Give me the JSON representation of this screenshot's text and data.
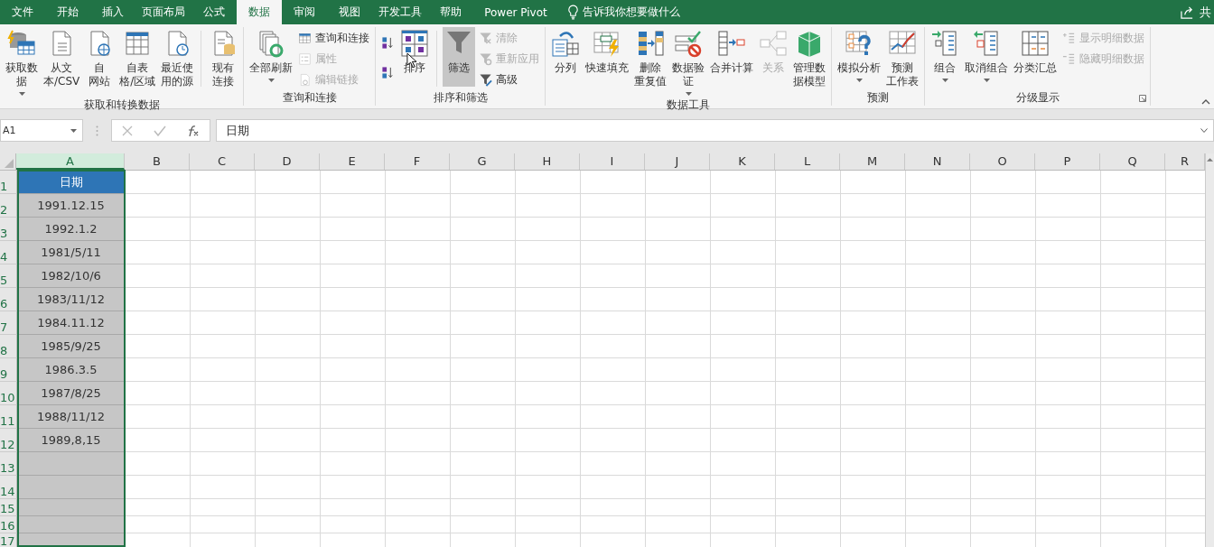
{
  "tabs": [
    {
      "label": "文件",
      "selected": false
    },
    {
      "label": "开始",
      "selected": false
    },
    {
      "label": "插入",
      "selected": false
    },
    {
      "label": "页面布局",
      "selected": false
    },
    {
      "label": "公式",
      "selected": false
    },
    {
      "label": "数据",
      "selected": true
    },
    {
      "label": "审阅",
      "selected": false
    },
    {
      "label": "视图",
      "selected": false
    },
    {
      "label": "开发工具",
      "selected": false
    },
    {
      "label": "帮助",
      "selected": false
    },
    {
      "label": "Power Pivot",
      "selected": false
    }
  ],
  "tell_me": "告诉我你想要做什么",
  "share": "共",
  "ribbon_groups": [
    {
      "label": "获取和转换数据",
      "items": [
        {
          "kind": "large",
          "lines": [
            "获取数",
            "据"
          ],
          "dropdown": true,
          "disabled": false,
          "pressed": false
        },
        {
          "kind": "large",
          "lines": [
            "从文",
            "本/CSV"
          ],
          "dropdown": false,
          "disabled": false,
          "pressed": false
        },
        {
          "kind": "large",
          "lines": [
            "自",
            "网站"
          ],
          "dropdown": false,
          "disabled": false,
          "pressed": false
        },
        {
          "kind": "large",
          "lines": [
            "自表",
            "格/区域"
          ],
          "dropdown": false,
          "disabled": false,
          "pressed": false
        },
        {
          "kind": "large",
          "lines": [
            "最近使",
            "用的源"
          ],
          "dropdown": false,
          "disabled": false,
          "pressed": false
        },
        {
          "kind": "separator"
        },
        {
          "kind": "large",
          "lines": [
            "现有",
            "连接"
          ],
          "dropdown": false,
          "disabled": false,
          "pressed": false
        }
      ]
    },
    {
      "label": "查询和连接",
      "items": [
        {
          "kind": "large",
          "lines": [
            "全部刷新"
          ],
          "dropdown": true,
          "disabled": false,
          "pressed": false
        },
        {
          "kind": "stack",
          "items": [
            {
              "label": "查询和连接",
              "disabled": false
            },
            {
              "label": "属性",
              "disabled": true
            },
            {
              "label": "编辑链接",
              "disabled": true
            }
          ]
        }
      ]
    },
    {
      "label": "排序和筛选",
      "items": [
        {
          "kind": "stack",
          "items": [
            {
              "kind": "icon"
            },
            {
              "kind": "icon"
            }
          ]
        },
        {
          "kind": "large",
          "lines": [
            "排序"
          ],
          "dropdown": false,
          "disabled": false,
          "pressed": false
        },
        {
          "kind": "separator"
        },
        {
          "kind": "large",
          "lines": [
            "筛选"
          ],
          "dropdown": false,
          "disabled": false,
          "pressed": true
        },
        {
          "kind": "stack",
          "items": [
            {
              "label": "清除",
              "disabled": true
            },
            {
              "label": "重新应用",
              "disabled": true
            },
            {
              "label": "高级",
              "disabled": false
            }
          ]
        }
      ]
    },
    {
      "label": "数据工具",
      "items": [
        {
          "kind": "large",
          "lines": [
            "分列"
          ],
          "dropdown": false,
          "disabled": false,
          "pressed": false
        },
        {
          "kind": "large",
          "lines": [
            "快速填充"
          ],
          "dropdown": false,
          "disabled": false,
          "pressed": false
        },
        {
          "kind": "large",
          "lines": [
            "删除",
            "重复值"
          ],
          "dropdown": false,
          "disabled": false,
          "pressed": false
        },
        {
          "kind": "large",
          "lines": [
            "数据验",
            "证"
          ],
          "dropdown": true,
          "disabled": false,
          "pressed": false
        },
        {
          "kind": "large",
          "lines": [
            "合并计算"
          ],
          "dropdown": false,
          "disabled": false,
          "pressed": false
        },
        {
          "kind": "large",
          "lines": [
            "关系"
          ],
          "dropdown": false,
          "disabled": true,
          "pressed": false
        },
        {
          "kind": "large",
          "lines": [
            "管理数",
            "据模型"
          ],
          "dropdown": false,
          "disabled": false,
          "pressed": false
        }
      ]
    },
    {
      "label": "预测",
      "items": [
        {
          "kind": "large",
          "lines": [
            "模拟分析"
          ],
          "dropdown": true,
          "disabled": false,
          "pressed": false
        },
        {
          "kind": "large",
          "lines": [
            "预测",
            "工作表"
          ],
          "dropdown": false,
          "disabled": false,
          "pressed": false
        }
      ]
    },
    {
      "label": "分级显示",
      "launcher": true,
      "items": [
        {
          "kind": "large",
          "lines": [
            "组合"
          ],
          "dropdown": true,
          "disabled": false,
          "pressed": false
        },
        {
          "kind": "large",
          "lines": [
            "取消组合"
          ],
          "dropdown": true,
          "disabled": false,
          "pressed": false
        },
        {
          "kind": "large",
          "lines": [
            "分类汇总"
          ],
          "dropdown": false,
          "disabled": false,
          "pressed": false
        },
        {
          "kind": "stack",
          "items": [
            {
              "label": "显示明细数据",
              "disabled": true
            },
            {
              "label": "隐藏明细数据",
              "disabled": true
            }
          ]
        }
      ]
    }
  ],
  "name_box": "A1",
  "formula": "日期",
  "columns": [
    {
      "label": "A",
      "selected": true
    },
    {
      "label": "B",
      "selected": false
    },
    {
      "label": "C",
      "selected": false
    },
    {
      "label": "D",
      "selected": false
    },
    {
      "label": "E",
      "selected": false
    },
    {
      "label": "F",
      "selected": false
    },
    {
      "label": "G",
      "selected": false
    },
    {
      "label": "H",
      "selected": false
    },
    {
      "label": "I",
      "selected": false
    },
    {
      "label": "J",
      "selected": false
    },
    {
      "label": "K",
      "selected": false
    },
    {
      "label": "L",
      "selected": false
    },
    {
      "label": "M",
      "selected": false
    },
    {
      "label": "N",
      "selected": false
    },
    {
      "label": "O",
      "selected": false
    },
    {
      "label": "P",
      "selected": false
    },
    {
      "label": "Q",
      "selected": false
    },
    {
      "label": "R",
      "selected": false
    }
  ],
  "rows": [
    {
      "number": "1",
      "kind": "header",
      "a": "日期"
    },
    {
      "number": "2",
      "kind": "data",
      "a": "1991.12.15"
    },
    {
      "number": "3",
      "kind": "data",
      "a": "1992.1.2"
    },
    {
      "number": "4",
      "kind": "data",
      "a": "1981/5/11"
    },
    {
      "number": "5",
      "kind": "data",
      "a": "1982/10/6"
    },
    {
      "number": "6",
      "kind": "data",
      "a": "1983/11/12"
    },
    {
      "number": "7",
      "kind": "data",
      "a": "1984.11.12"
    },
    {
      "number": "8",
      "kind": "data",
      "a": "1985/9/25"
    },
    {
      "number": "9",
      "kind": "data",
      "a": "1986.3.5"
    },
    {
      "number": "10",
      "kind": "data",
      "a": "1987/8/25"
    },
    {
      "number": "11",
      "kind": "data",
      "a": "1988/11/12"
    },
    {
      "number": "12",
      "kind": "data",
      "a": "1989,8,15"
    },
    {
      "number": "13",
      "kind": "data"
    },
    {
      "number": "14",
      "kind": "data"
    },
    {
      "number": "15",
      "kind": "data"
    },
    {
      "number": "16",
      "kind": "data"
    },
    {
      "number": "17",
      "kind": "data"
    }
  ]
}
